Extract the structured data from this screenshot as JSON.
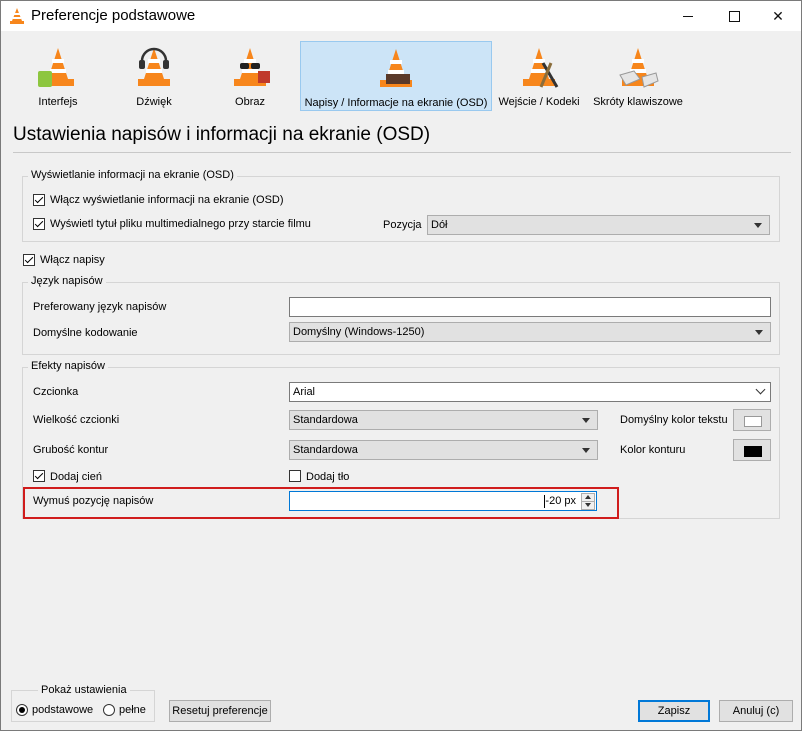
{
  "window": {
    "title": "Preferencje podstawowe"
  },
  "tabs": [
    {
      "label": "Interfejs"
    },
    {
      "label": "Dźwięk"
    },
    {
      "label": "Obraz"
    },
    {
      "label": "Napisy / Informacje na ekranie (OSD)",
      "active": true
    },
    {
      "label": "Wejście / Kodeki"
    },
    {
      "label": "Skróty klawiszowe"
    }
  ],
  "page": {
    "heading": "Ustawienia napisów i informacji na ekranie (OSD)"
  },
  "osd": {
    "group_title": "Wyświetlanie informacji na ekranie (OSD)",
    "enable_osd_label": "Włącz wyświetlanie informacji na ekranie (OSD)",
    "enable_osd_checked": true,
    "show_title_label": "Wyświetl tytuł pliku multimedialnego przy starcie filmu",
    "show_title_checked": true,
    "position_label": "Pozycja",
    "position_value": "Dół"
  },
  "subtitles": {
    "enable_label": "Włącz napisy",
    "enable_checked": true
  },
  "language": {
    "group_title": "Język napisów",
    "preferred_label": "Preferowany język napisów",
    "preferred_value": "",
    "encoding_label": "Domyślne kodowanie",
    "encoding_value": "Domyślny (Windows-1250)"
  },
  "effects": {
    "group_title": "Efekty napisów",
    "font_label": "Czcionka",
    "font_value": "Arial",
    "size_label": "Wielkość czcionki",
    "size_value": "Standardowa",
    "text_color_label": "Domyślny kolor tekstu",
    "text_color": "#ffffff",
    "outline_label": "Grubość kontur",
    "outline_value": "Standardowa",
    "outline_color_label": "Kolor konturu",
    "outline_color": "#000000",
    "shadow_label": "Dodaj cień",
    "shadow_checked": true,
    "background_label": "Dodaj tło",
    "background_checked": false,
    "force_position_label": "Wymuś pozycję napisów",
    "force_position_value": "-20 px"
  },
  "footer": {
    "show_settings_title": "Pokaż ustawienia",
    "basic_label": "podstawowe",
    "full_label": "pełne",
    "selected": "podstawowe",
    "reset_label": "Resetuj preferencje",
    "save_label": "Zapisz",
    "cancel_label": "Anuluj (c)"
  },
  "colors": {
    "accent": "#0078d7",
    "highlight_frame": "#d01c1c",
    "active_tab": "#cce4f7"
  },
  "icons": {
    "app": "vlc-cone-icon",
    "tabs": [
      "interface-cone-icon",
      "audio-headphones-cone-icon",
      "video-glasses-cone-icon",
      "subtitles-osd-cone-icon",
      "input-codecs-cone-icon",
      "hotkeys-cone-icon"
    ]
  }
}
